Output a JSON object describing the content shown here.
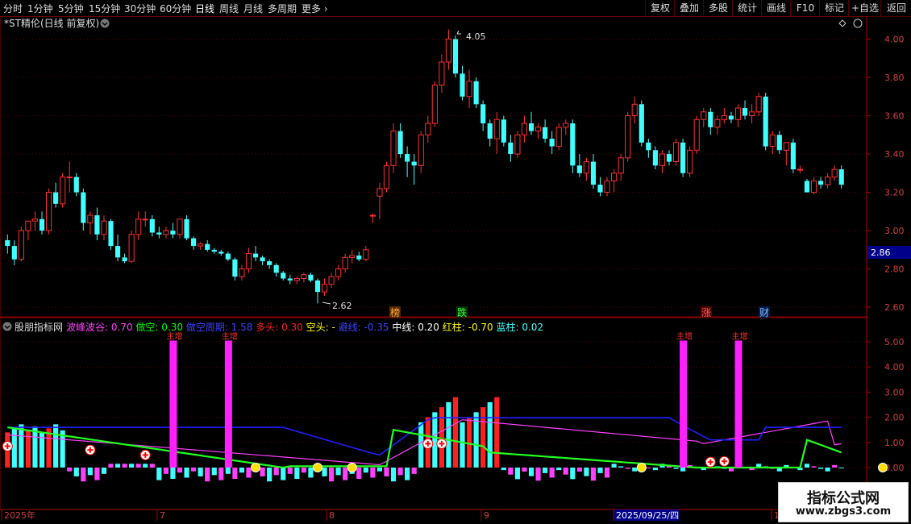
{
  "toolbar": {
    "periods": [
      "分时",
      "1分钟",
      "5分钟",
      "15分钟",
      "30分钟",
      "60分钟",
      "日线",
      "周线",
      "月线",
      "多周期",
      "更多"
    ],
    "active_period": "日线",
    "right_buttons": [
      "复权",
      "叠加",
      "多股",
      "统计",
      "画线",
      "F10",
      "标记",
      "+自选",
      "返回"
    ]
  },
  "main_chart": {
    "title": "*ST精伦(日线 前复权)",
    "price_ticks": [
      "4.00",
      "3.80",
      "3.60",
      "3.40",
      "3.20",
      "3.00",
      "2.80",
      "2.60"
    ],
    "price_tick_values": [
      4.0,
      3.8,
      3.6,
      3.4,
      3.2,
      3.0,
      2.8,
      2.6
    ],
    "current_price": "2.86",
    "high_label": "4.05",
    "low_label": "2.62",
    "markers": [
      "榜",
      "跌",
      "涨",
      "财"
    ]
  },
  "indicator": {
    "name": "股朋指标网",
    "params": [
      {
        "label": "波峰波谷:",
        "value": "0.70",
        "color": "#ff40ff"
      },
      {
        "label": "做空:",
        "value": "0.30",
        "color": "#00ff00"
      },
      {
        "label": "做空周期:",
        "value": "1.58",
        "color": "#4040ff"
      },
      {
        "label": "多头:",
        "value": "0.30",
        "color": "#ff2020"
      },
      {
        "label": "空头:",
        "value": "-",
        "color": "#ffff00"
      },
      {
        "label": "避线:",
        "value": "-0.35",
        "color": "#4040ff"
      },
      {
        "label": "中线:",
        "value": "0.20",
        "color": "#ffffff"
      },
      {
        "label": "红柱:",
        "value": "-0.70",
        "color": "#ffff00"
      },
      {
        "label": "蓝柱:",
        "value": "0.02",
        "color": "#40ffff"
      }
    ],
    "ticks": [
      "5.00",
      "4.00",
      "3.00",
      "2.00",
      "1.00",
      "0.00"
    ],
    "tick_values": [
      5,
      4,
      3,
      2,
      1,
      0
    ],
    "spike_label": "主增"
  },
  "time_axis": {
    "labels": [
      "2025年",
      "7",
      "8",
      "9",
      "2025/09/25/四",
      "11"
    ]
  },
  "watermark": {
    "title": "指标公式网",
    "url": "www.zbgs3.com"
  },
  "chart_data": {
    "type": "candlestick",
    "title": "*ST精伦(日线 前复权)",
    "ylim": [
      2.55,
      4.12
    ],
    "candles": [
      [
        2.95,
        2.98,
        2.88,
        2.92
      ],
      [
        2.92,
        2.95,
        2.82,
        2.85
      ],
      [
        2.85,
        3.02,
        2.84,
        3.0
      ],
      [
        3.0,
        3.04,
        2.95,
        3.05
      ],
      [
        3.05,
        3.1,
        3.0,
        3.06
      ],
      [
        3.06,
        3.1,
        2.98,
        3.0
      ],
      [
        3.0,
        3.22,
        2.98,
        3.2
      ],
      [
        3.2,
        3.25,
        3.12,
        3.14
      ],
      [
        3.14,
        3.3,
        3.12,
        3.28
      ],
      [
        3.28,
        3.36,
        3.2,
        3.28
      ],
      [
        3.28,
        3.3,
        3.18,
        3.2
      ],
      [
        3.2,
        3.22,
        3.0,
        3.04
      ],
      [
        3.04,
        3.1,
        2.98,
        3.08
      ],
      [
        3.08,
        3.12,
        2.95,
        2.98
      ],
      [
        2.98,
        3.08,
        2.95,
        3.05
      ],
      [
        3.05,
        3.06,
        2.9,
        2.92
      ],
      [
        2.92,
        2.98,
        2.84,
        2.86
      ],
      [
        2.86,
        2.88,
        2.83,
        2.84
      ],
      [
        2.84,
        3.0,
        2.83,
        2.98
      ],
      [
        2.98,
        3.1,
        2.95,
        3.06
      ],
      [
        3.06,
        3.1,
        3.02,
        3.06
      ],
      [
        3.06,
        3.08,
        2.97,
        2.99
      ],
      [
        2.99,
        3.02,
        2.96,
        2.98
      ],
      [
        2.98,
        3.02,
        2.96,
        3.0
      ],
      [
        3.0,
        3.04,
        2.96,
        2.98
      ],
      [
        2.98,
        3.06,
        2.96,
        3.06
      ],
      [
        3.06,
        3.08,
        2.95,
        2.96
      ],
      [
        2.96,
        2.97,
        2.9,
        2.92
      ],
      [
        2.92,
        2.94,
        2.9,
        2.93
      ],
      [
        2.93,
        2.95,
        2.89,
        2.9
      ],
      [
        2.9,
        2.91,
        2.88,
        2.89
      ],
      [
        2.89,
        2.9,
        2.87,
        2.88
      ],
      [
        2.88,
        2.89,
        2.84,
        2.85
      ],
      [
        2.85,
        2.86,
        2.74,
        2.76
      ],
      [
        2.76,
        2.82,
        2.74,
        2.8
      ],
      [
        2.8,
        2.91,
        2.78,
        2.88
      ],
      [
        2.88,
        2.92,
        2.84,
        2.86
      ],
      [
        2.86,
        2.87,
        2.82,
        2.84
      ],
      [
        2.84,
        2.85,
        2.8,
        2.82
      ],
      [
        2.82,
        2.83,
        2.76,
        2.78
      ],
      [
        2.78,
        2.79,
        2.74,
        2.75
      ],
      [
        2.75,
        2.77,
        2.72,
        2.74
      ],
      [
        2.74,
        2.76,
        2.72,
        2.75
      ],
      [
        2.75,
        2.78,
        2.73,
        2.77
      ],
      [
        2.77,
        2.78,
        2.73,
        2.74
      ],
      [
        2.74,
        2.75,
        2.62,
        2.68
      ],
      [
        2.68,
        2.75,
        2.66,
        2.72
      ],
      [
        2.72,
        2.78,
        2.7,
        2.76
      ],
      [
        2.76,
        2.82,
        2.74,
        2.8
      ],
      [
        2.8,
        2.88,
        2.78,
        2.86
      ],
      [
        2.86,
        2.9,
        2.83,
        2.87
      ],
      [
        2.87,
        2.89,
        2.84,
        2.85
      ],
      [
        2.85,
        2.92,
        2.84,
        2.9
      ],
      [
        3.08,
        3.09,
        3.04,
        3.08
      ],
      [
        3.18,
        3.25,
        3.06,
        3.22
      ],
      [
        3.22,
        3.36,
        3.2,
        3.34
      ],
      [
        3.34,
        3.56,
        3.3,
        3.52
      ],
      [
        3.52,
        3.56,
        3.38,
        3.4
      ],
      [
        3.4,
        3.44,
        3.28,
        3.36
      ],
      [
        3.36,
        3.4,
        3.24,
        3.34
      ],
      [
        3.34,
        3.52,
        3.3,
        3.5
      ],
      [
        3.5,
        3.6,
        3.46,
        3.56
      ],
      [
        3.56,
        3.78,
        3.54,
        3.76
      ],
      [
        3.76,
        3.92,
        3.72,
        3.88
      ],
      [
        3.88,
        4.05,
        3.84,
        4.0
      ],
      [
        4.0,
        4.02,
        3.8,
        3.82
      ],
      [
        3.82,
        3.86,
        3.68,
        3.7
      ],
      [
        3.7,
        3.84,
        3.64,
        3.78
      ],
      [
        3.78,
        3.8,
        3.64,
        3.66
      ],
      [
        3.66,
        3.68,
        3.52,
        3.56
      ],
      [
        3.56,
        3.58,
        3.44,
        3.48
      ],
      [
        3.48,
        3.62,
        3.4,
        3.58
      ],
      [
        3.58,
        3.6,
        3.44,
        3.46
      ],
      [
        3.46,
        3.5,
        3.36,
        3.4
      ],
      [
        3.4,
        3.52,
        3.38,
        3.5
      ],
      [
        3.5,
        3.6,
        3.46,
        3.56
      ],
      [
        3.56,
        3.62,
        3.5,
        3.52
      ],
      [
        3.52,
        3.56,
        3.48,
        3.54
      ],
      [
        3.54,
        3.58,
        3.46,
        3.48
      ],
      [
        3.48,
        3.52,
        3.4,
        3.44
      ],
      [
        3.44,
        3.56,
        3.42,
        3.54
      ],
      [
        3.54,
        3.58,
        3.5,
        3.56
      ],
      [
        3.56,
        3.58,
        3.3,
        3.34
      ],
      [
        3.34,
        3.4,
        3.28,
        3.3
      ],
      [
        3.3,
        3.38,
        3.26,
        3.36
      ],
      [
        3.36,
        3.4,
        3.22,
        3.24
      ],
      [
        3.24,
        3.28,
        3.18,
        3.2
      ],
      [
        3.2,
        3.28,
        3.18,
        3.26
      ],
      [
        3.26,
        3.32,
        3.2,
        3.3
      ],
      [
        3.3,
        3.4,
        3.26,
        3.38
      ],
      [
        3.38,
        3.62,
        3.36,
        3.6
      ],
      [
        3.6,
        3.7,
        3.56,
        3.66
      ],
      [
        3.66,
        3.68,
        3.44,
        3.46
      ],
      [
        3.46,
        3.48,
        3.38,
        3.42
      ],
      [
        3.42,
        3.44,
        3.32,
        3.34
      ],
      [
        3.34,
        3.42,
        3.3,
        3.4
      ],
      [
        3.4,
        3.42,
        3.34,
        3.36
      ],
      [
        3.36,
        3.48,
        3.34,
        3.46
      ],
      [
        3.46,
        3.48,
        3.28,
        3.3
      ],
      [
        3.3,
        3.44,
        3.28,
        3.42
      ],
      [
        3.42,
        3.6,
        3.4,
        3.58
      ],
      [
        3.58,
        3.64,
        3.54,
        3.62
      ],
      [
        3.62,
        3.64,
        3.5,
        3.54
      ],
      [
        3.54,
        3.6,
        3.5,
        3.58
      ],
      [
        3.58,
        3.64,
        3.56,
        3.6
      ],
      [
        3.6,
        3.62,
        3.56,
        3.58
      ],
      [
        3.58,
        3.66,
        3.54,
        3.64
      ],
      [
        3.64,
        3.68,
        3.58,
        3.6
      ],
      [
        3.6,
        3.66,
        3.56,
        3.62
      ],
      [
        3.62,
        3.72,
        3.6,
        3.7
      ],
      [
        3.7,
        3.72,
        3.42,
        3.44
      ],
      [
        3.44,
        3.52,
        3.4,
        3.5
      ],
      [
        3.5,
        3.52,
        3.4,
        3.42
      ],
      [
        3.42,
        3.46,
        3.34,
        3.46
      ],
      [
        3.46,
        3.48,
        3.3,
        3.32
      ],
      [
        3.32,
        3.34,
        3.3,
        3.32
      ],
      [
        3.26,
        3.27,
        3.2,
        3.2
      ],
      [
        3.2,
        3.28,
        3.19,
        3.26
      ],
      [
        3.26,
        3.28,
        3.22,
        3.24
      ],
      [
        3.24,
        3.3,
        3.22,
        3.28
      ],
      [
        3.28,
        3.34,
        3.26,
        3.32
      ],
      [
        3.32,
        3.34,
        3.22,
        3.24
      ]
    ]
  }
}
